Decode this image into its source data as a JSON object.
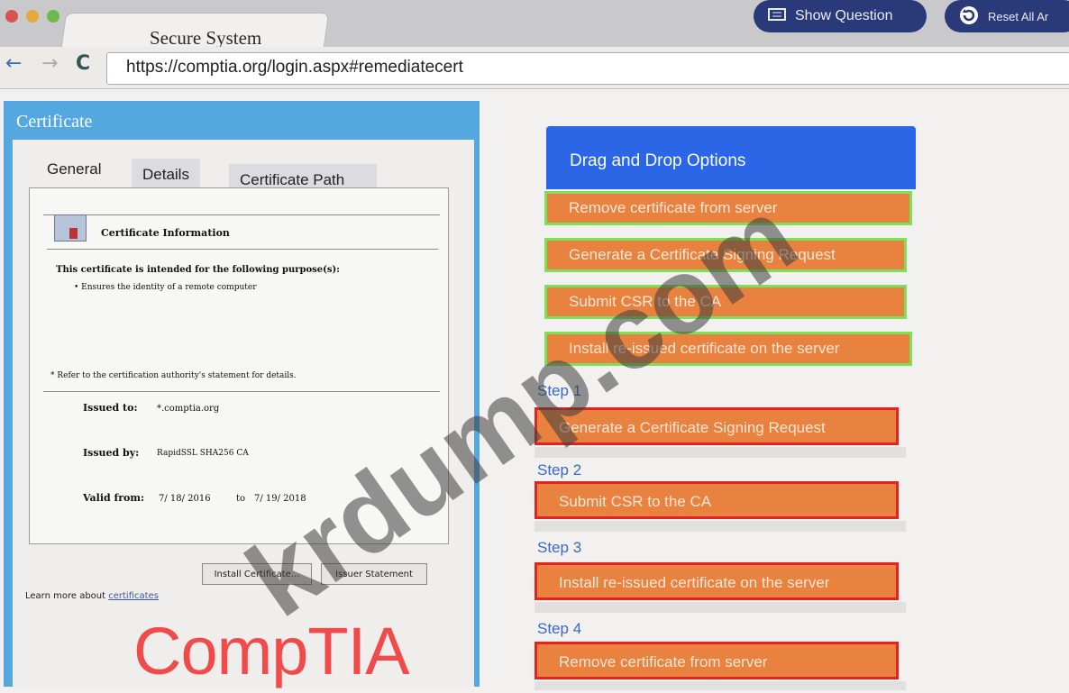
{
  "browser": {
    "tab_title": "Secure System",
    "url": "https://comptia.org/login.aspx#remediatecert",
    "show_question_label": "Show Question",
    "reset_label": "Reset All Ar",
    "icons": [
      "back-arrow-icon",
      "forward-arrow-icon",
      "reload-icon",
      "question-panel-icon",
      "reset-icon"
    ]
  },
  "certificate": {
    "title": "Certificate",
    "tabs": [
      "General",
      "Details",
      "Certificate Path"
    ],
    "info_heading": "Certificate Information",
    "purpose_heading": "This certificate is intended for the following purpose(s):",
    "purpose_item": "• Ensures the identity of a remote computer",
    "refer_note": "* Refer to the certification authority's statement for details.",
    "issued_to_label": "Issued to:",
    "issued_to_value": "*.comptia.org",
    "issued_by_label": "Issued by:",
    "issued_by_value": "RapidSSL SHA256 CA",
    "valid_from_label": "Valid from:",
    "valid_from_value": "7/ 18/ 2016",
    "valid_to_word": "to",
    "valid_to_value": "7/ 19/ 2018",
    "install_button": "Install Certificate...",
    "issuer_button": "Issuer Statement",
    "learn_prefix": "Learn more about",
    "learn_link": "certificates"
  },
  "drag_drop": {
    "header": "Drag and Drop Options",
    "options": [
      "Remove certificate from server",
      "Generate a Certificate Signing Request",
      "Submit CSR to the CA",
      "Install re-issued certificate on the server"
    ]
  },
  "steps": [
    {
      "label": "Step 1",
      "value": "Generate a Certificate Signing Request"
    },
    {
      "label": "Step 2",
      "value": "Submit CSR to the CA"
    },
    {
      "label": "Step 3",
      "value": "Install re-issued certificate on the server"
    },
    {
      "label": "Step 4",
      "value": "Remove certificate from server"
    }
  ],
  "logo_text": "CompTIA",
  "watermark_text": "krdump.com",
  "colors": {
    "accent_blue": "#2a66e6",
    "option_orange": "#e8823e",
    "option_border_green": "#7ce05c",
    "slot_border_red": "#e02424",
    "dialog_blue": "#55a7df",
    "logo_red": "#f04a4a"
  }
}
